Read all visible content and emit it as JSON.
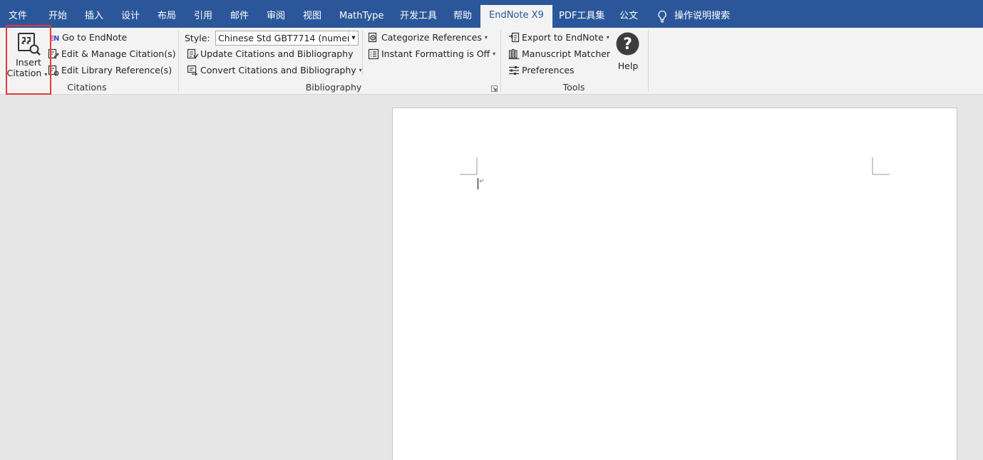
{
  "tabs": [
    {
      "label": "文件"
    },
    {
      "label": "开始"
    },
    {
      "label": "插入"
    },
    {
      "label": "设计"
    },
    {
      "label": "布局"
    },
    {
      "label": "引用"
    },
    {
      "label": "邮件"
    },
    {
      "label": "审阅"
    },
    {
      "label": "视图"
    },
    {
      "label": "MathType"
    },
    {
      "label": "开发工具"
    },
    {
      "label": "帮助"
    },
    {
      "label": "EndNote X9",
      "active": true
    },
    {
      "label": "PDF工具集"
    },
    {
      "label": "公文"
    }
  ],
  "tell_me": {
    "label": "操作说明搜索",
    "icon": "lightbulb-icon"
  },
  "colors": {
    "tabbar": "#2b579a",
    "ribbon": "#f3f3f3",
    "highlight": "#e23b3b",
    "workspace": "#e6e6e6"
  },
  "citations": {
    "group_label": "Citations",
    "insert_citation": {
      "line1": "Insert",
      "line2": "Citation",
      "icon": "insert-citation-icon"
    },
    "go_to_endnote": "Go to EndNote",
    "edit_manage": "Edit & Manage Citation(s)",
    "edit_library": "Edit Library Reference(s)"
  },
  "bibliography": {
    "group_label": "Bibliography",
    "style_label": "Style:",
    "style_value": "Chinese Std GBT7714 (numer...",
    "update": "Update Citations and Bibliography",
    "convert": "Convert Citations and Bibliography",
    "categorize": "Categorize References",
    "instant_formatting": "Instant Formatting is Off"
  },
  "tools": {
    "group_label": "Tools",
    "export": "Export to EndNote",
    "manuscript": "Manuscript Matcher",
    "preferences": "Preferences",
    "help": "Help"
  }
}
